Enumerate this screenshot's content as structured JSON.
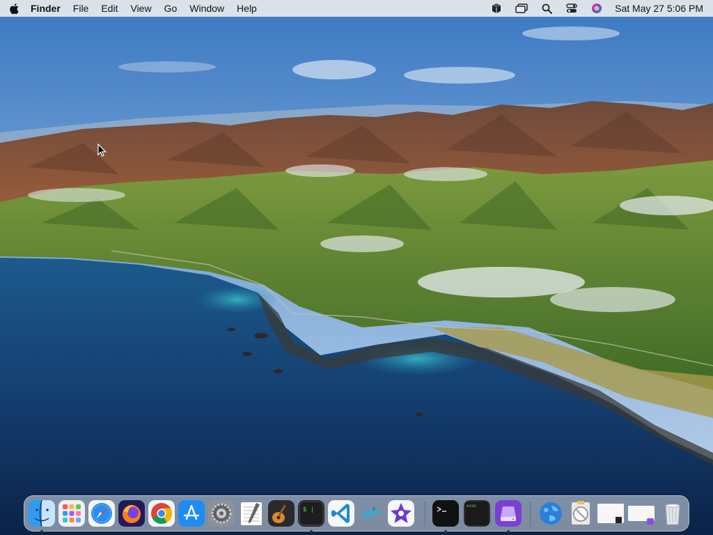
{
  "menubar": {
    "app_name": "Finder",
    "menus": [
      "File",
      "Edit",
      "View",
      "Go",
      "Window",
      "Help"
    ],
    "clock": "Sat May 27  5:06 PM",
    "status_icons": [
      "box-icon",
      "window-switch-icon",
      "search-icon",
      "control-center-icon",
      "siri-icon"
    ]
  },
  "dock": {
    "apps": [
      {
        "name": "Finder",
        "running": true
      },
      {
        "name": "Launchpad",
        "running": false
      },
      {
        "name": "Safari",
        "running": false
      },
      {
        "name": "Firefox",
        "running": false
      },
      {
        "name": "Google Chrome",
        "running": false
      },
      {
        "name": "App Store",
        "running": false
      },
      {
        "name": "System Preferences",
        "running": false
      },
      {
        "name": "TextEdit",
        "running": false
      },
      {
        "name": "GarageBand",
        "running": false
      },
      {
        "name": "Terminal",
        "running": true
      },
      {
        "name": "Visual Studio Code",
        "running": false
      },
      {
        "name": "MySQL Workbench",
        "running": false
      },
      {
        "name": "iMovie",
        "running": false
      },
      {
        "name": "Terminal Window",
        "running": true
      },
      {
        "name": "Exec",
        "running": false
      },
      {
        "name": "Storage App",
        "running": true
      },
      {
        "name": "Network",
        "running": false
      },
      {
        "name": "Preview",
        "running": false
      },
      {
        "name": "Window Thumbnail 1",
        "running": false
      },
      {
        "name": "Window Thumbnail 2",
        "running": false
      },
      {
        "name": "Trash",
        "running": false
      }
    ],
    "terminal_label": "$ |",
    "exec_label": "exec"
  },
  "colors": {
    "sky_top": "#3f7fc6",
    "sky_bottom": "#b9d0e6",
    "ocean_deep": "#0e2a52",
    "ocean_shallow": "#2bb3c7",
    "hills": "#5f8a2f",
    "mountains": "#8a5436"
  }
}
